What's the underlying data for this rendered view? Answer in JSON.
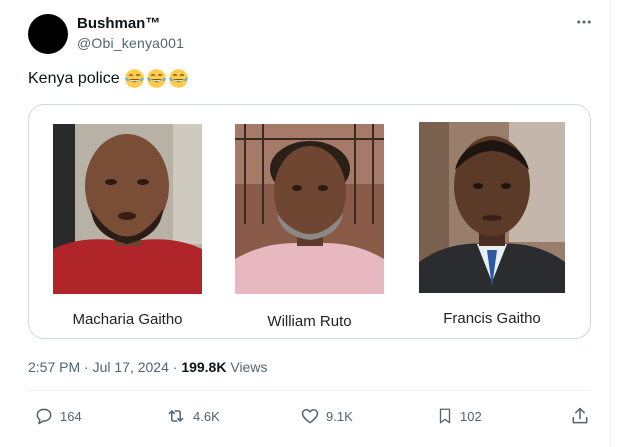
{
  "author": {
    "name": "Bushman™",
    "handle": "@Obi_kenya001"
  },
  "tweet": {
    "text": "Kenya police",
    "emojis": [
      "face-with-tears-of-joy",
      "face-with-tears-of-joy",
      "face-with-tears-of-joy"
    ]
  },
  "image_captions": [
    "Macharia Gaitho",
    "William Ruto",
    "Francis Gaitho"
  ],
  "meta": {
    "timestamp": "2:57 PM · Jul 17, 2024 · ",
    "views_count": "199.8K",
    "views_label": " Views"
  },
  "actions": {
    "replies": "164",
    "reposts": "4.6K",
    "likes": "9.1K",
    "bookmarks": "102"
  },
  "colors": {
    "text_primary": "#0f1419",
    "text_secondary": "#536471",
    "border": "#cfd9de"
  }
}
